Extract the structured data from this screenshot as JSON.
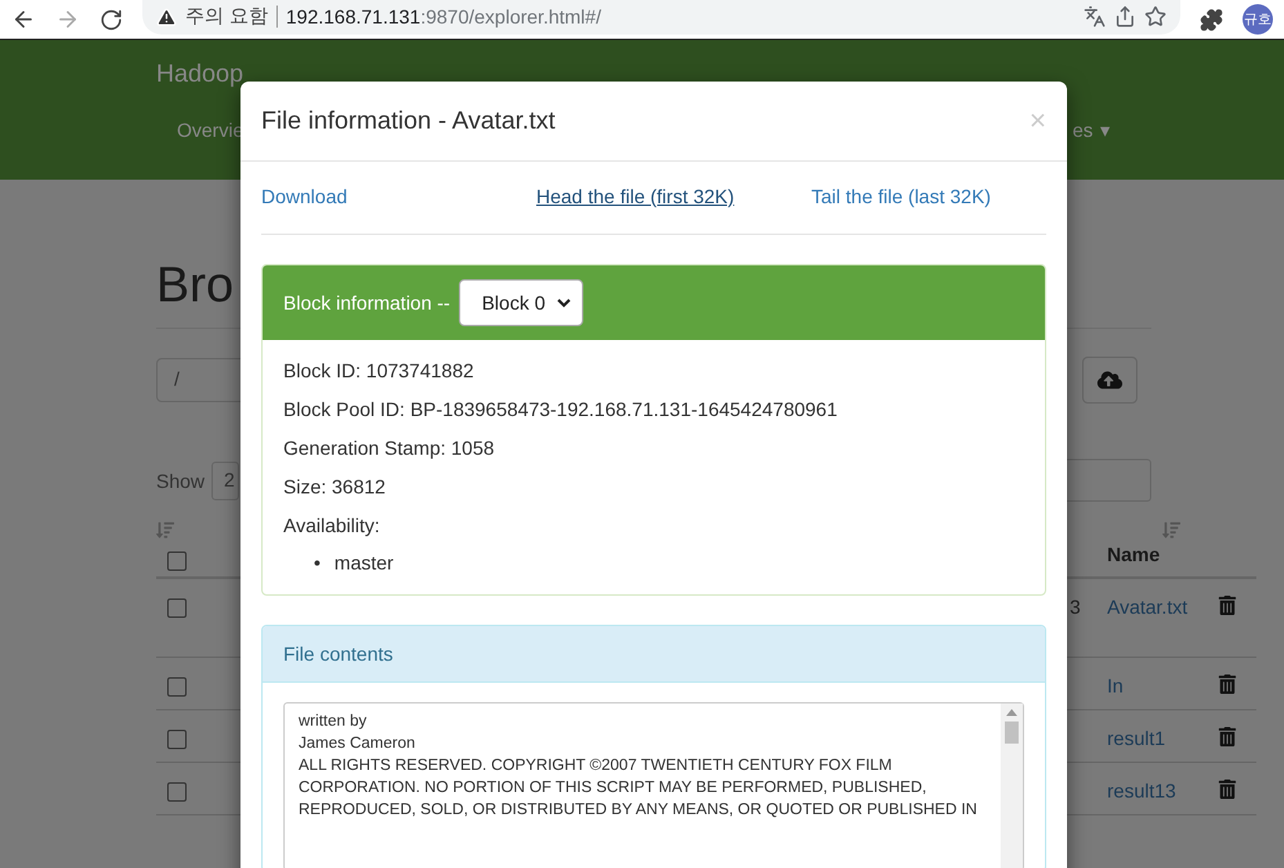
{
  "browser": {
    "security_label": "주의 요함",
    "url_host": "192.168.71.131",
    "url_path": ":9870/explorer.html#/",
    "profile": "규호"
  },
  "page": {
    "brand": "Hadoop",
    "nav_items": [
      {
        "label": "Overvie"
      },
      {
        "label": "es",
        "caret": "▾"
      }
    ],
    "heading": "Bro",
    "path_value": "/",
    "show_label": "Show",
    "show_value": "2",
    "name_column": "Name",
    "header_checked": false,
    "rows": [
      {
        "fragment": "3",
        "name": "Avatar.txt",
        "checked": false
      },
      {
        "name": "In",
        "checked": false
      },
      {
        "name": "result1",
        "checked": false
      },
      {
        "name": "result13",
        "checked": false
      }
    ]
  },
  "modal": {
    "title": "File information - Avatar.txt",
    "close": "×",
    "links": [
      {
        "label": "Download",
        "hovered": false
      },
      {
        "label": "Head the file (first 32K)",
        "hovered": true
      },
      {
        "label": "Tail the file (last 32K)",
        "hovered": false
      }
    ],
    "block": {
      "heading": "Block information --",
      "select_value": "Block 0",
      "fields": [
        "Block ID: 1073741882",
        "Block Pool ID: BP-1839658473-192.168.71.131-1645424780961",
        "Generation Stamp: 1058",
        "Size: 36812",
        "Availability:"
      ],
      "hosts": [
        {
          "bullet": "•",
          "name": "master"
        }
      ]
    },
    "contents": {
      "heading": "File contents",
      "lines": [
        "written by",
        "James Cameron",
        "ALL RIGHTS RESERVED. COPYRIGHT ©2007 TWENTIETH CENTURY FOX FILM CORPORATION. NO PORTION OF THIS SCRIPT MAY BE PERFORMED, PUBLISHED, REPRODUCED, SOLD, OR DISTRIBUTED BY ANY MEANS, OR QUOTED OR PUBLISHED IN"
      ]
    }
  }
}
